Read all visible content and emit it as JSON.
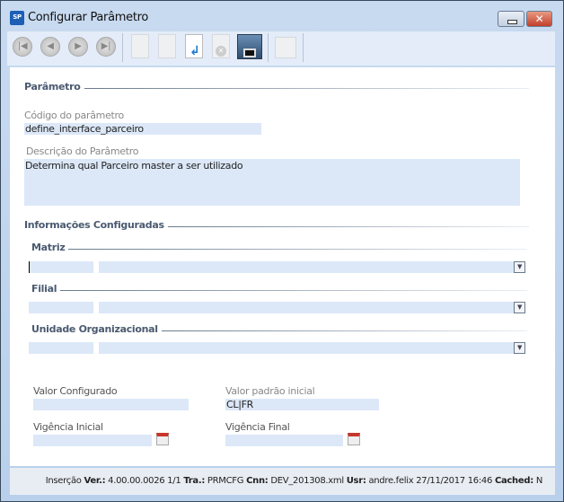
{
  "window": {
    "title": "Configurar Parâmetro",
    "logo": "SP",
    "close": "✕"
  },
  "toolbar": {
    "icons": [
      "first-icon",
      "previous-icon",
      "next-icon",
      "last-icon",
      "new-icon",
      "edit-icon",
      "undo-icon",
      "delete-icon",
      "save-icon",
      "lock-icon"
    ]
  },
  "parametro": {
    "section": "Parâmetro",
    "codigo_label": "Código do parâmetro",
    "codigo_value": "define_interface_parceiro",
    "descricao_label": "Descrição do Parâmetro",
    "descricao_value": "Determina qual Parceiro master a ser utilizado"
  },
  "info": {
    "section": "Informações Configuradas",
    "matriz": "Matriz",
    "filial": "Filial",
    "unidade": "Unidade Organizacional"
  },
  "valores": {
    "valor_configurado_label": "Valor Configurado",
    "valor_configurado_value": "",
    "valor_padrao_label": "Valor padrão inicial",
    "valor_padrao_value": "CL|FR",
    "vigencia_inicial_label": "Vigência Inicial",
    "vigencia_final_label": "Vigência Final"
  },
  "status": {
    "mode": "Inserção",
    "ver_label": "Ver.:",
    "ver": "4.00.00.0026 1/1",
    "tra_label": "Tra.:",
    "tra": "PRMCFG",
    "cnn_label": "Cnn:",
    "cnn": "DEV_201308.xml",
    "usr_label": "Usr:",
    "usr": "andre.felix 27/11/2017 16:46",
    "cached_label": "Cached:",
    "cached": "N"
  }
}
